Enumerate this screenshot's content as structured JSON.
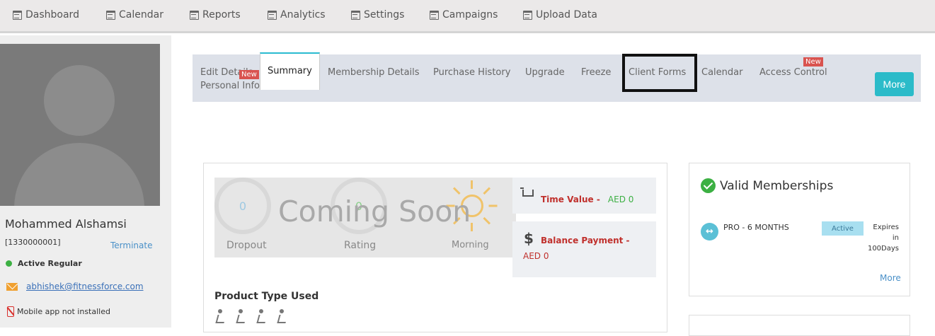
{
  "topnav": {
    "items": [
      {
        "label": "Dashboard",
        "icon": "calendar-icon"
      },
      {
        "label": "Calendar",
        "icon": "calendar-icon"
      },
      {
        "label": "Reports",
        "icon": "calendar-icon"
      },
      {
        "label": "Analytics",
        "icon": "calendar-icon"
      },
      {
        "label": "Settings",
        "icon": "calendar-icon"
      },
      {
        "label": "Campaigns",
        "icon": "calendar-icon"
      },
      {
        "label": "Upload Data",
        "icon": "calendar-icon"
      }
    ]
  },
  "profile": {
    "name": "Mohammed Alshamsi",
    "member_id": "[1330000001]",
    "terminate_label": "Terminate",
    "status": "Active Regular",
    "email": "abhishek@fitnessforce.com",
    "mobile_status": "Mobile app not installed",
    "status_color": "#3cb043"
  },
  "tabs": {
    "edit_details": "Edit Details",
    "personal_info": "Personal Info",
    "summary": "Summary",
    "membership_details": "Membership Details",
    "purchase_history": "Purchase History",
    "upgrade": "Upgrade",
    "freeze": "Freeze",
    "client_forms": "Client Forms",
    "calendar": "Calendar",
    "access_control": "Access Control",
    "new_badge": "New",
    "more_label": "More",
    "accent_color": "#2bbbc9"
  },
  "stats": {
    "dropout_value": "0",
    "dropout_label": "Dropout",
    "rating_value": "0",
    "rating_label": "Rating",
    "morning_label": "Morning",
    "coming_soon": "Coming Soon"
  },
  "values": {
    "time_value_label": "Time Value -",
    "time_value_amount": "AED 0",
    "balance_label": "Balance Payment -",
    "balance_amount": "AED 0"
  },
  "product_type": {
    "title": "Product Type Used"
  },
  "memberships": {
    "title": "Valid Memberships",
    "items": [
      {
        "name": "PRO - 6 MONTHS",
        "status": "Active",
        "expires_line1": "Expires",
        "expires_line2": "in",
        "expires_line3": "100Days"
      }
    ],
    "more_label": "More"
  }
}
